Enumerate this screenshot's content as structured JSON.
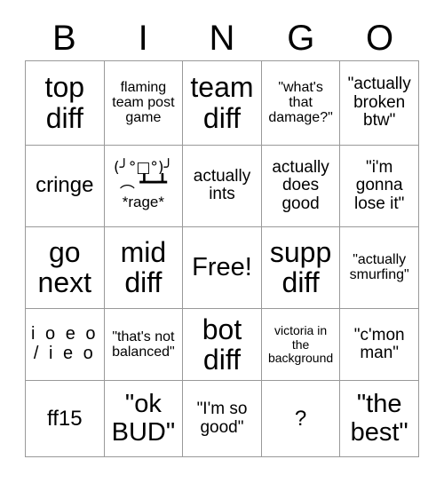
{
  "card": {
    "headers": [
      "B",
      "I",
      "N",
      "G",
      "O"
    ],
    "free_space_label": "Free!",
    "rows": [
      [
        {
          "text": "top\ndiff",
          "size": "xl"
        },
        {
          "text": "flaming\nteam post\ngame",
          "size": "xs"
        },
        {
          "text": "team\ndiff",
          "size": "xl"
        },
        {
          "text": "\"what's\nthat\ndamage?\"",
          "size": "xs"
        },
        {
          "text": "\"actually\nbroken\nbtw\"",
          "size": "sm"
        }
      ],
      [
        {
          "text": "cringe",
          "size": "md"
        },
        {
          "art": "(╯°□°)╯︵ ┻━┻",
          "caption": "*rage*",
          "size": "art"
        },
        {
          "text": "actually\nints",
          "size": "sm"
        },
        {
          "text": "actually\ndoes\ngood",
          "size": "sm"
        },
        {
          "text": "\"i'm\ngonna\nlose it\"",
          "size": "sm"
        }
      ],
      [
        {
          "text": "go\nnext",
          "size": "xl"
        },
        {
          "text": "mid\ndiff",
          "size": "xl"
        },
        {
          "text": "Free!",
          "size": "lg"
        },
        {
          "text": "supp\ndiff",
          "size": "xl"
        },
        {
          "text": "\"actually\nsmurfing\"",
          "size": "xs"
        }
      ],
      [
        {
          "text": "i o e o\n/ i e o",
          "size": "spaced"
        },
        {
          "text": "\"that's not\nbalanced\"",
          "size": "xs"
        },
        {
          "text": "bot\ndiff",
          "size": "xl"
        },
        {
          "text": "victoria in\nthe\nbackground",
          "size": "xxs"
        },
        {
          "text": "\"c'mon\nman\"",
          "size": "sm"
        }
      ],
      [
        {
          "text": "ff15",
          "size": "md"
        },
        {
          "text": "\"ok\nBUD\"",
          "size": "lg"
        },
        {
          "text": "\"I'm so\ngood\"",
          "size": "sm"
        },
        {
          "text": "?",
          "size": "md"
        },
        {
          "text": "\"the\nbest\"",
          "size": "lg"
        }
      ]
    ]
  }
}
